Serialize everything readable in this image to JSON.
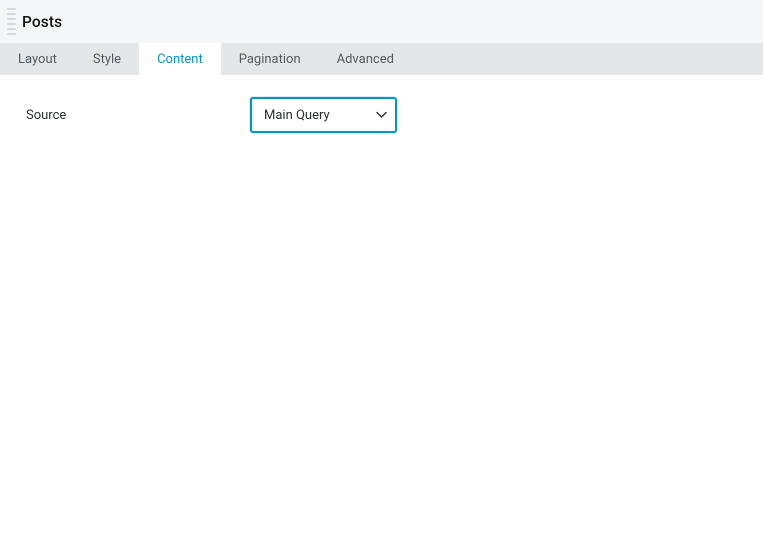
{
  "header": {
    "title": "Posts"
  },
  "tabs": [
    {
      "id": "layout",
      "label": "Layout",
      "active": false
    },
    {
      "id": "style",
      "label": "Style",
      "active": false
    },
    {
      "id": "content",
      "label": "Content",
      "active": true
    },
    {
      "id": "pagination",
      "label": "Pagination",
      "active": false
    },
    {
      "id": "advanced",
      "label": "Advanced",
      "active": false
    }
  ],
  "content": {
    "source": {
      "label": "Source",
      "value": "Main Query"
    }
  }
}
